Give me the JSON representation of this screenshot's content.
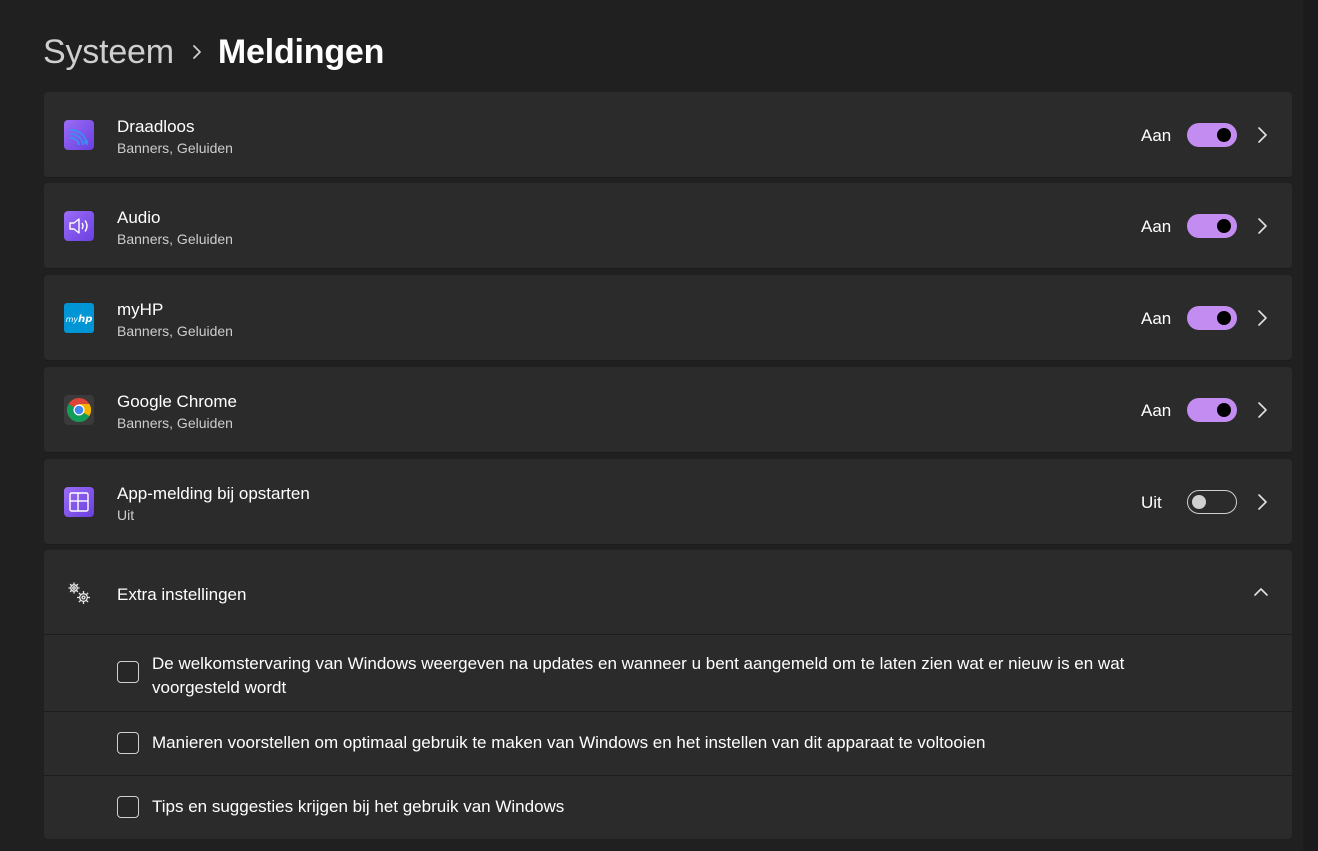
{
  "breadcrumb": {
    "parent": "Systeem",
    "current": "Meldingen"
  },
  "apps": [
    {
      "name": "Draadloos",
      "subtitle": "Banners, Geluiden",
      "state": "Aan",
      "enabled": true,
      "icon": "wireless-icon",
      "icon_color": "#8a5cf5"
    },
    {
      "name": "Audio",
      "subtitle": "Banners, Geluiden",
      "state": "Aan",
      "enabled": true,
      "icon": "speaker-icon",
      "icon_color": "#8a5cf5"
    },
    {
      "name": "myHP",
      "subtitle": "Banners, Geluiden",
      "state": "Aan",
      "enabled": true,
      "icon": "myhp-icon",
      "icon_color": "#0096d6"
    },
    {
      "name": "Google Chrome",
      "subtitle": "Banners, Geluiden",
      "state": "Aan",
      "enabled": true,
      "icon": "chrome-icon",
      "icon_color": "#4285f4"
    },
    {
      "name": "App-melding bij opstarten",
      "subtitle": "Uit",
      "state": "Uit",
      "enabled": false,
      "icon": "startup-app-icon",
      "icon_color": "#8a5cf5"
    }
  ],
  "extra": {
    "title": "Extra instellingen",
    "options": [
      {
        "label": "De welkomstervaring van Windows weergeven na updates en wanneer u bent aangemeld om te laten zien wat er nieuw is en wat voorgesteld wordt",
        "checked": false
      },
      {
        "label": "Manieren voorstellen om optimaal gebruik te maken van Windows en het instellen van dit apparaat te voltooien",
        "checked": false
      },
      {
        "label": "Tips en suggesties krijgen bij het gebruik van Windows",
        "checked": false
      }
    ]
  },
  "colors": {
    "background": "#202020",
    "card": "#2b2b2b",
    "accent": "#c28cf0"
  }
}
